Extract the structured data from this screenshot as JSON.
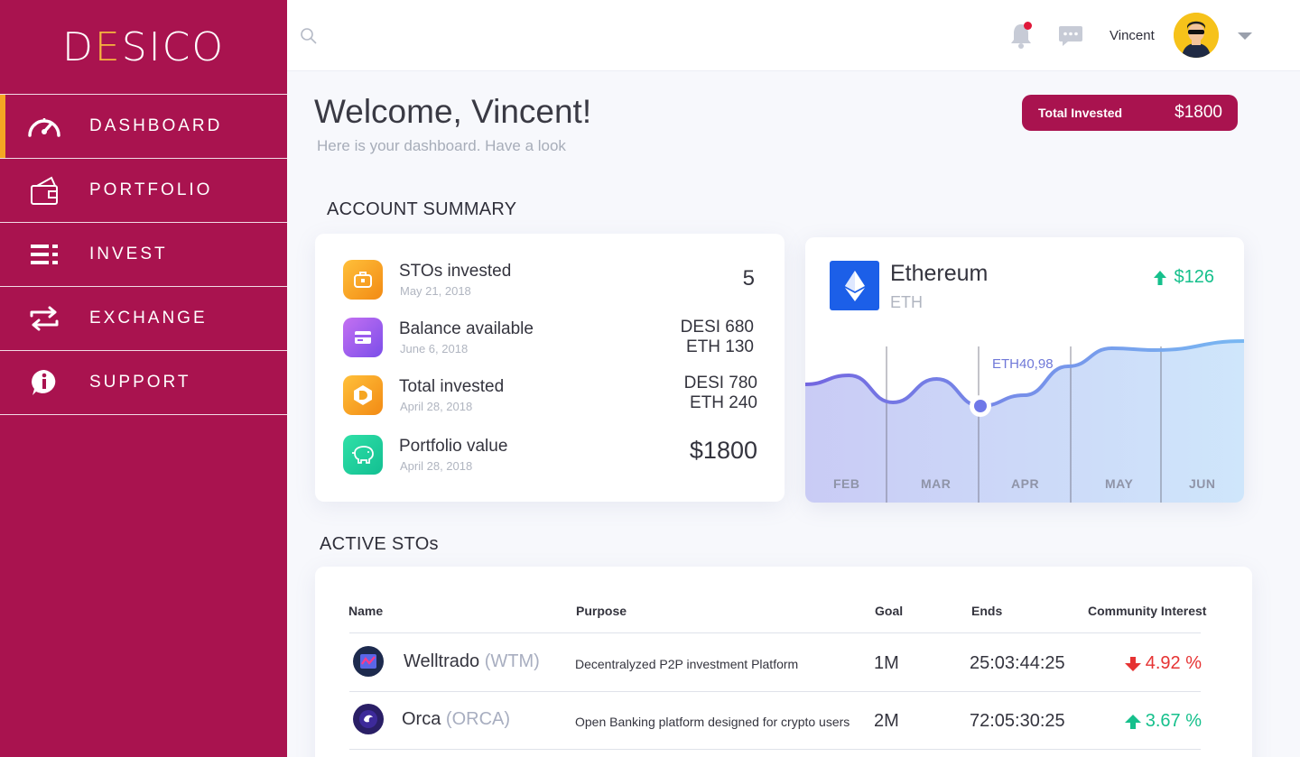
{
  "brand": {
    "logo_text_left": "D",
    "logo_text_e": "E",
    "logo_text_right": "SICO"
  },
  "sidebar": {
    "items": [
      {
        "label": "DASHBOARD",
        "icon": "speedometer-icon",
        "active": true
      },
      {
        "label": "PORTFOLIO",
        "icon": "wallet-icon",
        "active": false
      },
      {
        "label": "INVEST",
        "icon": "list-icon",
        "active": false
      },
      {
        "label": "EXCHANGE",
        "icon": "exchange-arrows-icon",
        "active": false
      },
      {
        "label": "SUPPORT",
        "icon": "info-bubble-icon",
        "active": false
      }
    ]
  },
  "header": {
    "search_icon": "search-icon",
    "user_name": "Vincent",
    "notification_dot_color": "#e0183a"
  },
  "welcome": {
    "title": "Welcome, Vincent!",
    "subtitle": "Here is your dashboard. Have a look"
  },
  "total_invested": {
    "label": "Total Invested",
    "value": "$1800"
  },
  "account_summary": {
    "title": "ACCOUNT SUMMARY",
    "rows": [
      {
        "title": "STOs invested",
        "date": "May 21, 2018",
        "value_line1": "5",
        "value_line2": "",
        "icon": "briefcase-icon",
        "color": "#f6a21b"
      },
      {
        "title": "Balance available",
        "date": "June 6, 2018",
        "value_line1": "DESI 680",
        "value_line2": "ETH 130",
        "icon": "card-icon",
        "color": "#a25ff0"
      },
      {
        "title": "Total invested",
        "date": "April 28, 2018",
        "value_line1": "DESI 780",
        "value_line2": "ETH 240",
        "icon": "desi-coin-icon",
        "color": "#f6a21b"
      },
      {
        "title": "Portfolio value",
        "date": "April 28, 2018",
        "value_line1": "$1800",
        "value_line2": "",
        "icon": "piggy-bank-icon",
        "color": "#19c99a"
      }
    ]
  },
  "ethereum": {
    "name": "Ethereum",
    "symbol": "ETH",
    "change": "$126",
    "change_direction": "up",
    "tooltip": "ETH40,98"
  },
  "chart_data": {
    "type": "area",
    "categories": [
      "FEB",
      "MAR",
      "APR",
      "MAY",
      "JUN"
    ],
    "x": [
      0,
      0.5,
      1,
      1.5,
      2,
      2.5,
      3,
      3.5,
      4,
      4.5
    ],
    "values": [
      0.52,
      0.62,
      0.32,
      0.58,
      0.28,
      0.4,
      0.72,
      0.92,
      0.9,
      1.0
    ],
    "highlight_index": 4,
    "highlight_label": "ETH40,98",
    "grid": true,
    "title": "",
    "xlabel": "",
    "ylabel": ""
  },
  "active_stos": {
    "title": "ACTIVE STOs",
    "columns": [
      "Name",
      "Purpose",
      "Goal",
      "Ends",
      "Community Interest"
    ],
    "rows": [
      {
        "name": "Welltrado",
        "ticker": "(WTM)",
        "purpose": "Decentralyzed P2P investment Platform",
        "goal": "1M",
        "ends": "25:03:44:25",
        "interest": "4.92 %",
        "direction": "down"
      },
      {
        "name": "Orca",
        "ticker": "(ORCA)",
        "purpose": "Open Banking platform designed for crypto users",
        "goal": "2M",
        "ends": "72:05:30:25",
        "interest": "3.67 %",
        "direction": "up"
      }
    ]
  },
  "colors": {
    "brand": "#a9134f",
    "accent": "#f5a623",
    "positive": "#16c08c",
    "negative": "#e63333",
    "chart_line": "#6f78d8"
  }
}
